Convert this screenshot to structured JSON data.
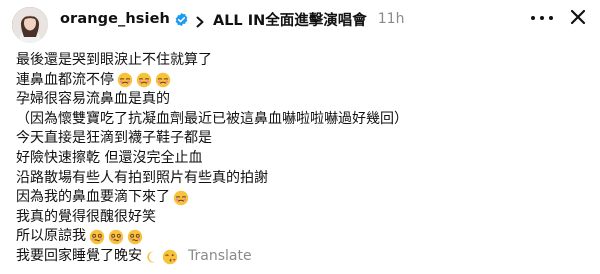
{
  "post": {
    "username": "orange_hsieh",
    "topic": "ALL IN全面進擊演唱會",
    "time": "11h",
    "translate_label": "Translate",
    "icons": {
      "avatar": "profile-photo",
      "verified": "verified-badge-icon",
      "chevron": "chevron-right-icon",
      "more": "more-icon",
      "close": "close-icon",
      "emoji_face": "face-with-tears-emoji",
      "emoji_woozy": "woozy-face-emoji",
      "emoji_moon": "crescent-moon-emoji",
      "emoji_kiss": "kissing-face-emoji"
    },
    "colors": {
      "verified_blue": "#1d9bf0",
      "muted_gray": "#8a8a8a"
    },
    "lines": [
      "最後還是哭到眼淚止不住就算了",
      "連鼻血都流不停",
      "孕婦很容易流鼻血是真的",
      "（因為懷雙寶吃了抗凝血劑最近已被這鼻血嚇啦啦嚇過好幾回）",
      "今天直接是狂滴到襪子鞋子都是",
      "好險快速擦乾 但還沒完全止血",
      "沿路散場有些人有拍到照片有些真的拍謝",
      "因為我的鼻血要滴下來了",
      "我真的覺得很醜很好笑",
      "所以原諒我",
      "我要回家睡覺了晚安"
    ]
  }
}
